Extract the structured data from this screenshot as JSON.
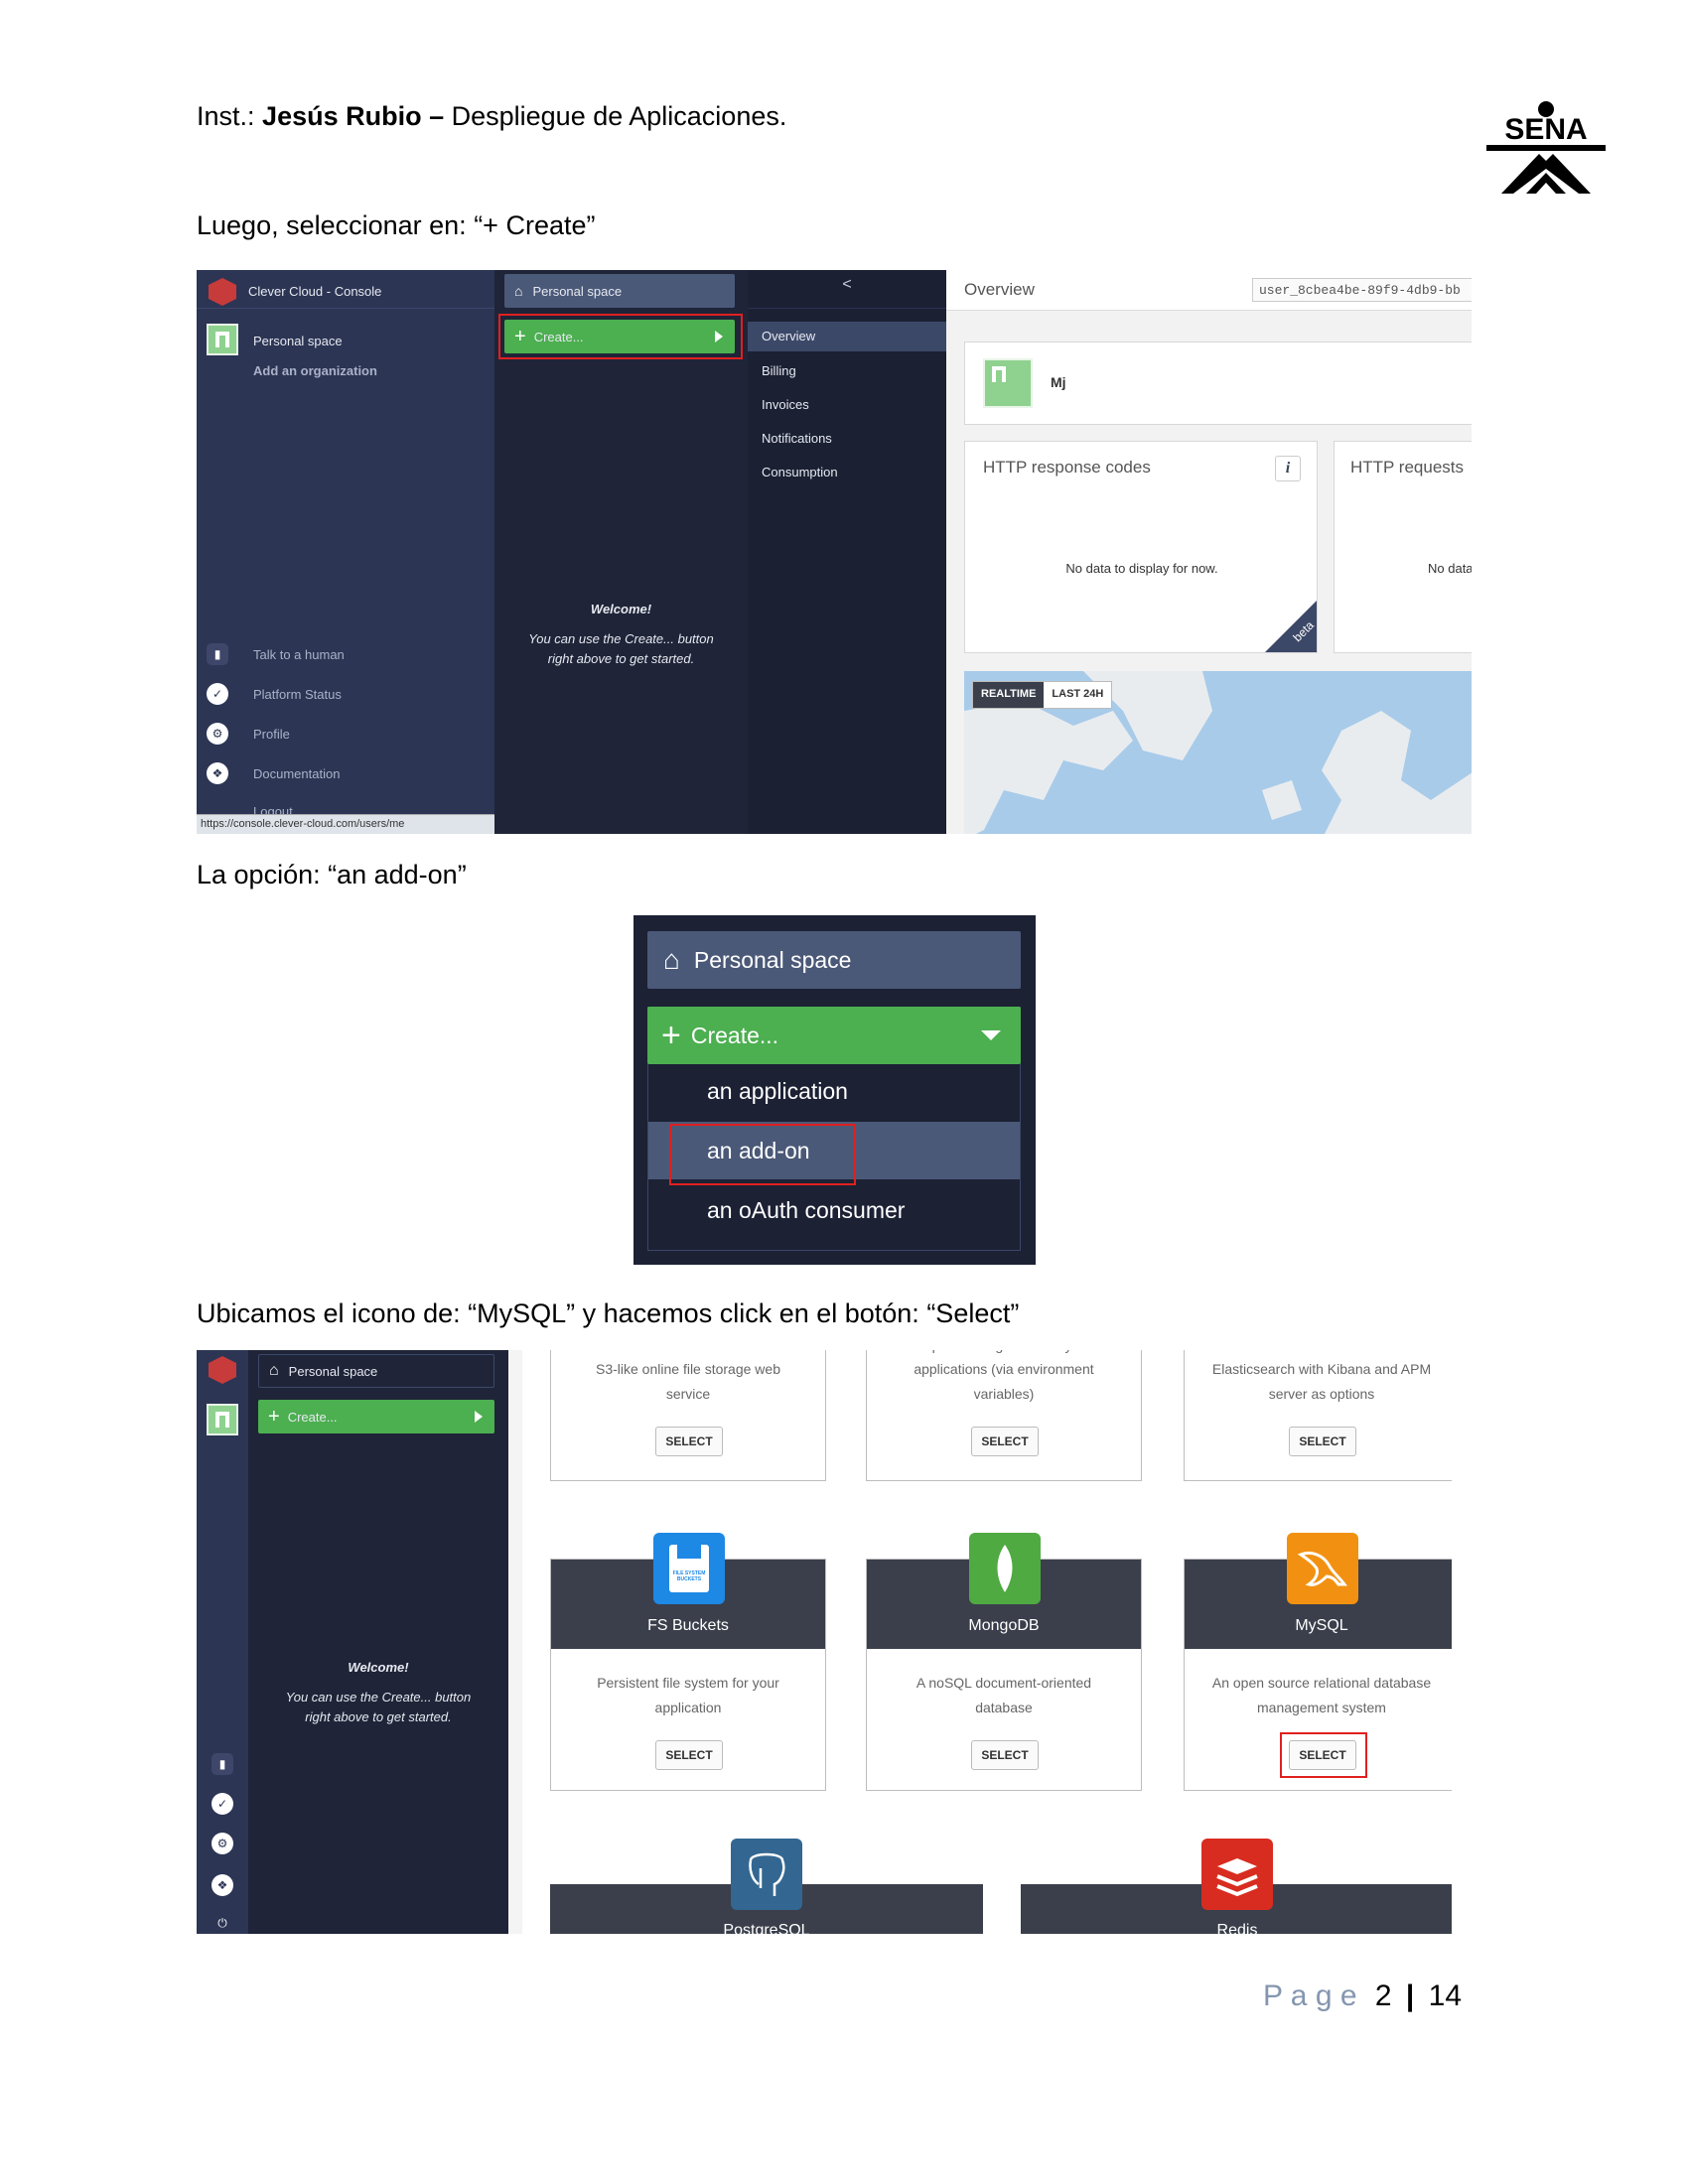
{
  "header": {
    "inst_prefix": "Inst.:",
    "instructor": "Jesús Rubio –",
    "course": "Despliegue de Aplicaciones.",
    "logo_text": "SENA"
  },
  "steps": [
    "Luego, seleccionar en: “+ Create”",
    "La opción: “an add-on”",
    "Ubicamos el icono de: “MySQL” y hacemos click en el botón: “Select”"
  ],
  "shot1": {
    "app_title": "Clever Cloud - Console",
    "personal_space": "Personal space",
    "add_org": "Add an organization",
    "create_label": "Create...",
    "collapse_glyph": "<",
    "welcome_title": "Welcome!",
    "welcome_body_1": "You can use the Create... button",
    "welcome_body_2": "right above to get started.",
    "submenu": [
      "Overview",
      "Billing",
      "Invoices",
      "Notifications",
      "Consumption"
    ],
    "footer_items": [
      "Talk to a human",
      "Platform Status",
      "Profile",
      "Documentation",
      "Logout"
    ],
    "status_url": "https://console.clever-cloud.com/users/me",
    "overview_title": "Overview",
    "user_id": "user_8cbea4be-89f9-4db9-bb",
    "user_name": "Mj",
    "card1_title": "HTTP response codes",
    "card1_info_glyph": "i",
    "card1_empty": "No data to display for now.",
    "beta_label": "beta",
    "card2_title": "HTTP requests",
    "card2_empty": "No data",
    "realtime_tab": "REALTIME",
    "last24_tab": "LAST 24H"
  },
  "shot2": {
    "personal_space": "Personal space",
    "create_label": "Create...",
    "options": [
      "an application",
      "an add-on",
      "an oAuth consumer"
    ]
  },
  "shot3": {
    "personal_space": "Personal space",
    "create_label": "Create...",
    "welcome_title": "Welcome!",
    "welcome_body_1": "You can use the Create... button",
    "welcome_body_2": "right above to get started.",
    "top_row": [
      {
        "desc_1": "S3-like online file storage web",
        "desc_2": "service",
        "button": "SELECT"
      },
      {
        "desc_0": "Expose configuration to your",
        "desc_1": "applications (via environment",
        "desc_2": "variables)",
        "button": "SELECT"
      },
      {
        "desc_1": "Elasticsearch with Kibana and APM",
        "desc_2": "server as options",
        "button": "SELECT"
      }
    ],
    "mid_row": [
      {
        "title": "FS Buckets",
        "icon_text": "FILE SYSTEM BUCKETS",
        "desc_1": "Persistent file system for your",
        "desc_2": "application",
        "button": "SELECT"
      },
      {
        "title": "MongoDB",
        "desc_1": "A noSQL document-oriented",
        "desc_2": "database",
        "button": "SELECT"
      },
      {
        "title": "MySQL",
        "desc_1": "An open source relational database",
        "desc_2": "management system",
        "button": "SELECT"
      }
    ],
    "bottom_row": [
      {
        "title": "PostgreSQL"
      },
      {
        "title": "Redis"
      }
    ]
  },
  "footer": {
    "page_word": "P a g e",
    "page_num": "2",
    "separator": "|",
    "total": "14"
  },
  "colors": {
    "sidebar": "#2c3554",
    "panel": "#1f2438",
    "create_green": "#4caf50",
    "highlight_red": "#e02020",
    "mysql_orange": "#f29111",
    "mongodb_green": "#4faa41",
    "fsbuckets_blue": "#1e88e5",
    "postgres_blue": "#336791",
    "redis_red": "#d82c20",
    "page_number_blue": "#8496b0"
  }
}
